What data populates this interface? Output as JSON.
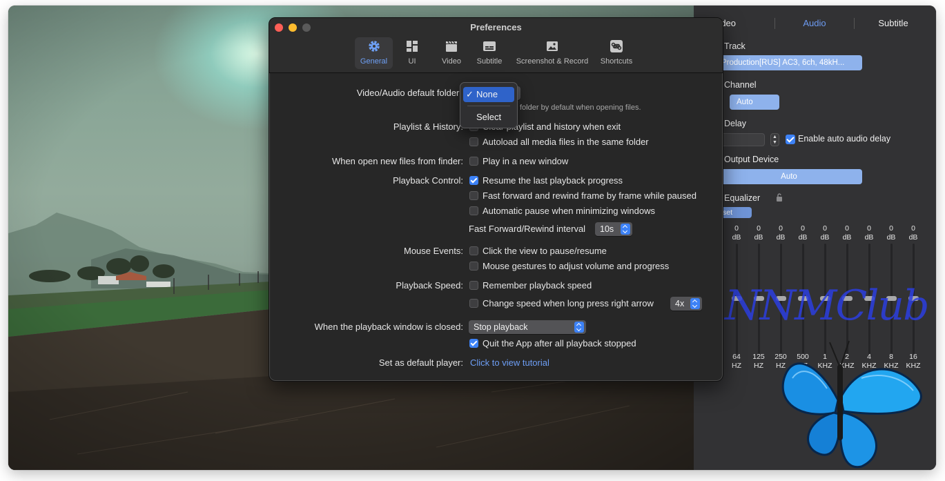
{
  "audio_panel": {
    "tabs": [
      "Video",
      "Audio",
      "Subtitle"
    ],
    "active_tab": "Audio",
    "track_label": "Track",
    "track_value": "Production[RUS] AC3, 6ch, 48kH...",
    "channel_label": "Channel",
    "channel_value": "Auto",
    "delay_label": "Delay",
    "auto_delay_label": "Enable auto audio delay",
    "auto_delay_checked": true,
    "output_label": "Output Device",
    "output_value": "Auto",
    "equalizer_label": "Equalizer",
    "preset_label": "set",
    "eq_bands": [
      {
        "value": "0",
        "unit": "dB",
        "freq": "64",
        "freq_unit": "HZ"
      },
      {
        "value": "0",
        "unit": "dB",
        "freq": "125",
        "freq_unit": "HZ"
      },
      {
        "value": "0",
        "unit": "dB",
        "freq": "250",
        "freq_unit": "HZ"
      },
      {
        "value": "0",
        "unit": "dB",
        "freq": "500",
        "freq_unit": "HZ"
      },
      {
        "value": "0",
        "unit": "dB",
        "freq": "1",
        "freq_unit": "KHZ"
      },
      {
        "value": "0",
        "unit": "dB",
        "freq": "2",
        "freq_unit": "KHZ"
      },
      {
        "value": "0",
        "unit": "dB",
        "freq": "4",
        "freq_unit": "KHZ"
      },
      {
        "value": "0",
        "unit": "dB",
        "freq": "8",
        "freq_unit": "KHZ"
      },
      {
        "value": "0",
        "unit": "dB",
        "freq": "16",
        "freq_unit": "KHZ"
      }
    ]
  },
  "watermark": "NNMClub",
  "prefs": {
    "title": "Preferences",
    "toolbar": [
      {
        "label": "General",
        "icon": "gear-icon",
        "active": true
      },
      {
        "label": "UI",
        "icon": "layout-icon",
        "active": false
      },
      {
        "label": "Video",
        "icon": "clapperboard-icon",
        "active": false
      },
      {
        "label": "Subtitle",
        "icon": "subtitle-icon",
        "active": false
      },
      {
        "label": "Screenshot & Record",
        "icon": "image-icon",
        "active": false
      },
      {
        "label": "Shortcuts",
        "icon": "command-icon",
        "active": false
      }
    ],
    "default_folder_label": "Video/Audio default folder:",
    "default_folder_hint": "folder by default when opening files.",
    "folder_menu": {
      "selected": "None",
      "items": [
        "None",
        "Select"
      ]
    },
    "playlist_label": "Playlist & History:",
    "playlist_opts": [
      "Clear playlist and history when exit",
      "Autoload all media files in the same folder"
    ],
    "playlist_clipped_text": "Clear playlist and history when exit",
    "finder_label": "When open new files from finder:",
    "finder_opt": "Play in a new window",
    "playback_label": "Playback Control:",
    "playback_opts": [
      "Resume the last playback progress",
      "Fast forward and rewind frame by frame while paused",
      "Automatic pause when minimizing windows"
    ],
    "ff_interval_label": "Fast Forward/Rewind interval",
    "ff_interval_value": "10s",
    "mouse_label": "Mouse Events:",
    "mouse_opts": [
      "Click the view to pause/resume",
      "Mouse gestures to adjust volume and progress"
    ],
    "speed_label": "Playback Speed:",
    "speed_opts": [
      "Remember playback speed",
      "Change speed when long press right arrow"
    ],
    "speed_value": "4x",
    "closed_label": "When the playback window is closed:",
    "closed_value": "Stop playback",
    "quit_opt": "Quit the App after all playback stopped",
    "default_player_label": "Set as default player:",
    "tutorial_link": "Click to view tutorial",
    "checks": {
      "resume_last": true,
      "quit_after_stop": true
    }
  },
  "colors": {
    "accent": "#3d82f6",
    "link": "#6d9ef5",
    "panel_bg": "#323234",
    "prefs_bg": "#272727"
  }
}
